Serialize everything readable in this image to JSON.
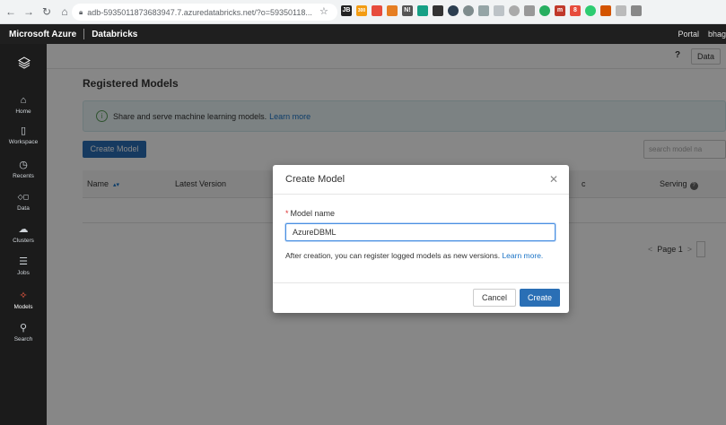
{
  "browser": {
    "url": "adb-5935011873683947.7.azuredatabricks.net/?o=59350118...",
    "ext_labels": [
      "JB",
      "300",
      "N!"
    ]
  },
  "azure_bar": {
    "brand": "Microsoft Azure",
    "product": "Databricks",
    "portal": "Portal",
    "user": "bhag"
  },
  "sidebar": {
    "items": [
      {
        "label": "Home",
        "icon": "home-icon"
      },
      {
        "label": "Workspace",
        "icon": "workspace-icon"
      },
      {
        "label": "Recents",
        "icon": "clock-icon"
      },
      {
        "label": "Data",
        "icon": "data-icon"
      },
      {
        "label": "Clusters",
        "icon": "clusters-icon"
      },
      {
        "label": "Jobs",
        "icon": "jobs-icon"
      },
      {
        "label": "Models",
        "icon": "models-icon",
        "active": true
      },
      {
        "label": "Search",
        "icon": "search-icon"
      }
    ]
  },
  "topbar": {
    "help": "?",
    "data_btn": "Data"
  },
  "page": {
    "title": "Registered Models",
    "banner_text": "Share and serve machine learning models.",
    "banner_link": "Learn more",
    "create_button": "Create Model",
    "search_placeholder": "search model na",
    "columns": {
      "name": "Name",
      "latest_version": "Latest Version",
      "c": "c",
      "serving": "Serving"
    },
    "pager": "Page 1"
  },
  "modal": {
    "title": "Create Model",
    "field_label": "Model name",
    "field_value": "AzureDBML",
    "helper_text": "After creation, you can register logged models as new versions.",
    "helper_link": "Learn more.",
    "cancel": "Cancel",
    "create": "Create"
  },
  "colors": {
    "primary": "#2a6fb5",
    "active_nav": "#ff5f46"
  }
}
